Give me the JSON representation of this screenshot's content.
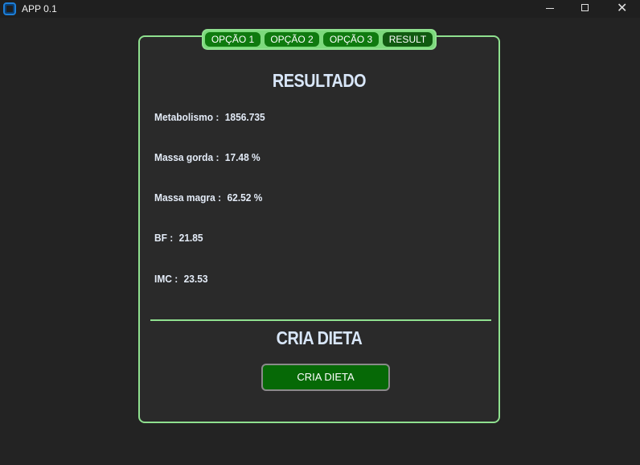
{
  "window": {
    "title": "APP 0.1",
    "close_glyph": "✕"
  },
  "tabs": [
    {
      "label": "OPÇÃO 1"
    },
    {
      "label": "OPÇÃO 2"
    },
    {
      "label": "OPÇÃO 3"
    },
    {
      "label": "RESULT"
    }
  ],
  "result": {
    "heading": "RESULTADO",
    "rows": [
      {
        "label": "Metabolismo :",
        "value": "1856.735"
      },
      {
        "label": "Massa gorda :",
        "value": "17.48 %"
      },
      {
        "label": "Massa magra :",
        "value": "62.52 %"
      },
      {
        "label": "BF :",
        "value": "21.85"
      },
      {
        "label": "IMC :",
        "value": "23.53"
      }
    ]
  },
  "diet": {
    "heading": "CRIA DIETA",
    "button_label": "CRIA DIETA"
  },
  "colors": {
    "background": "#232323",
    "panel": "#2a2a2a",
    "accent_border": "#8fe08f",
    "tab_green": "#0f7a0f",
    "button_green": "#066906",
    "text": "#d8e6f8"
  },
  "icons": {
    "app": "app-icon",
    "minimize": "minimize-icon",
    "maximize": "maximize-icon",
    "close": "close-icon"
  }
}
